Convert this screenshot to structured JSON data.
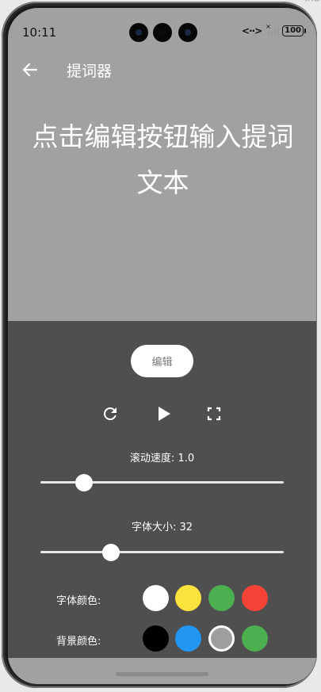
{
  "status_bar": {
    "time": "10:11",
    "network": "<··>",
    "battery": "100"
  },
  "app_bar": {
    "title": "提词器",
    "back_icon": "arrow-left-icon"
  },
  "prompt": {
    "text": "点击编辑按钮输入提词文本"
  },
  "controls": {
    "edit_label": "编辑",
    "reset_icon": "refresh-icon",
    "play_icon": "play-icon",
    "fullscreen_icon": "fullscreen-icon"
  },
  "speed": {
    "label": "滚动速度: 1.0",
    "value": 1.0,
    "fraction": 0.18
  },
  "font_size": {
    "label": "字体大小: 32",
    "value": 32,
    "fraction": 0.29
  },
  "font_color": {
    "label": "字体颜色:",
    "options": [
      "#ffffff",
      "#fbe23d",
      "#4caf50",
      "#f44336"
    ]
  },
  "bg_color": {
    "label": "背景颜色:",
    "options": [
      "#000000",
      "#2196f3",
      "#9e9e9e",
      "#4caf50"
    ],
    "selected": 2
  },
  "colors": {
    "screen_bg": "#a1a1a1",
    "panel_bg": "#4f4f4f"
  }
}
